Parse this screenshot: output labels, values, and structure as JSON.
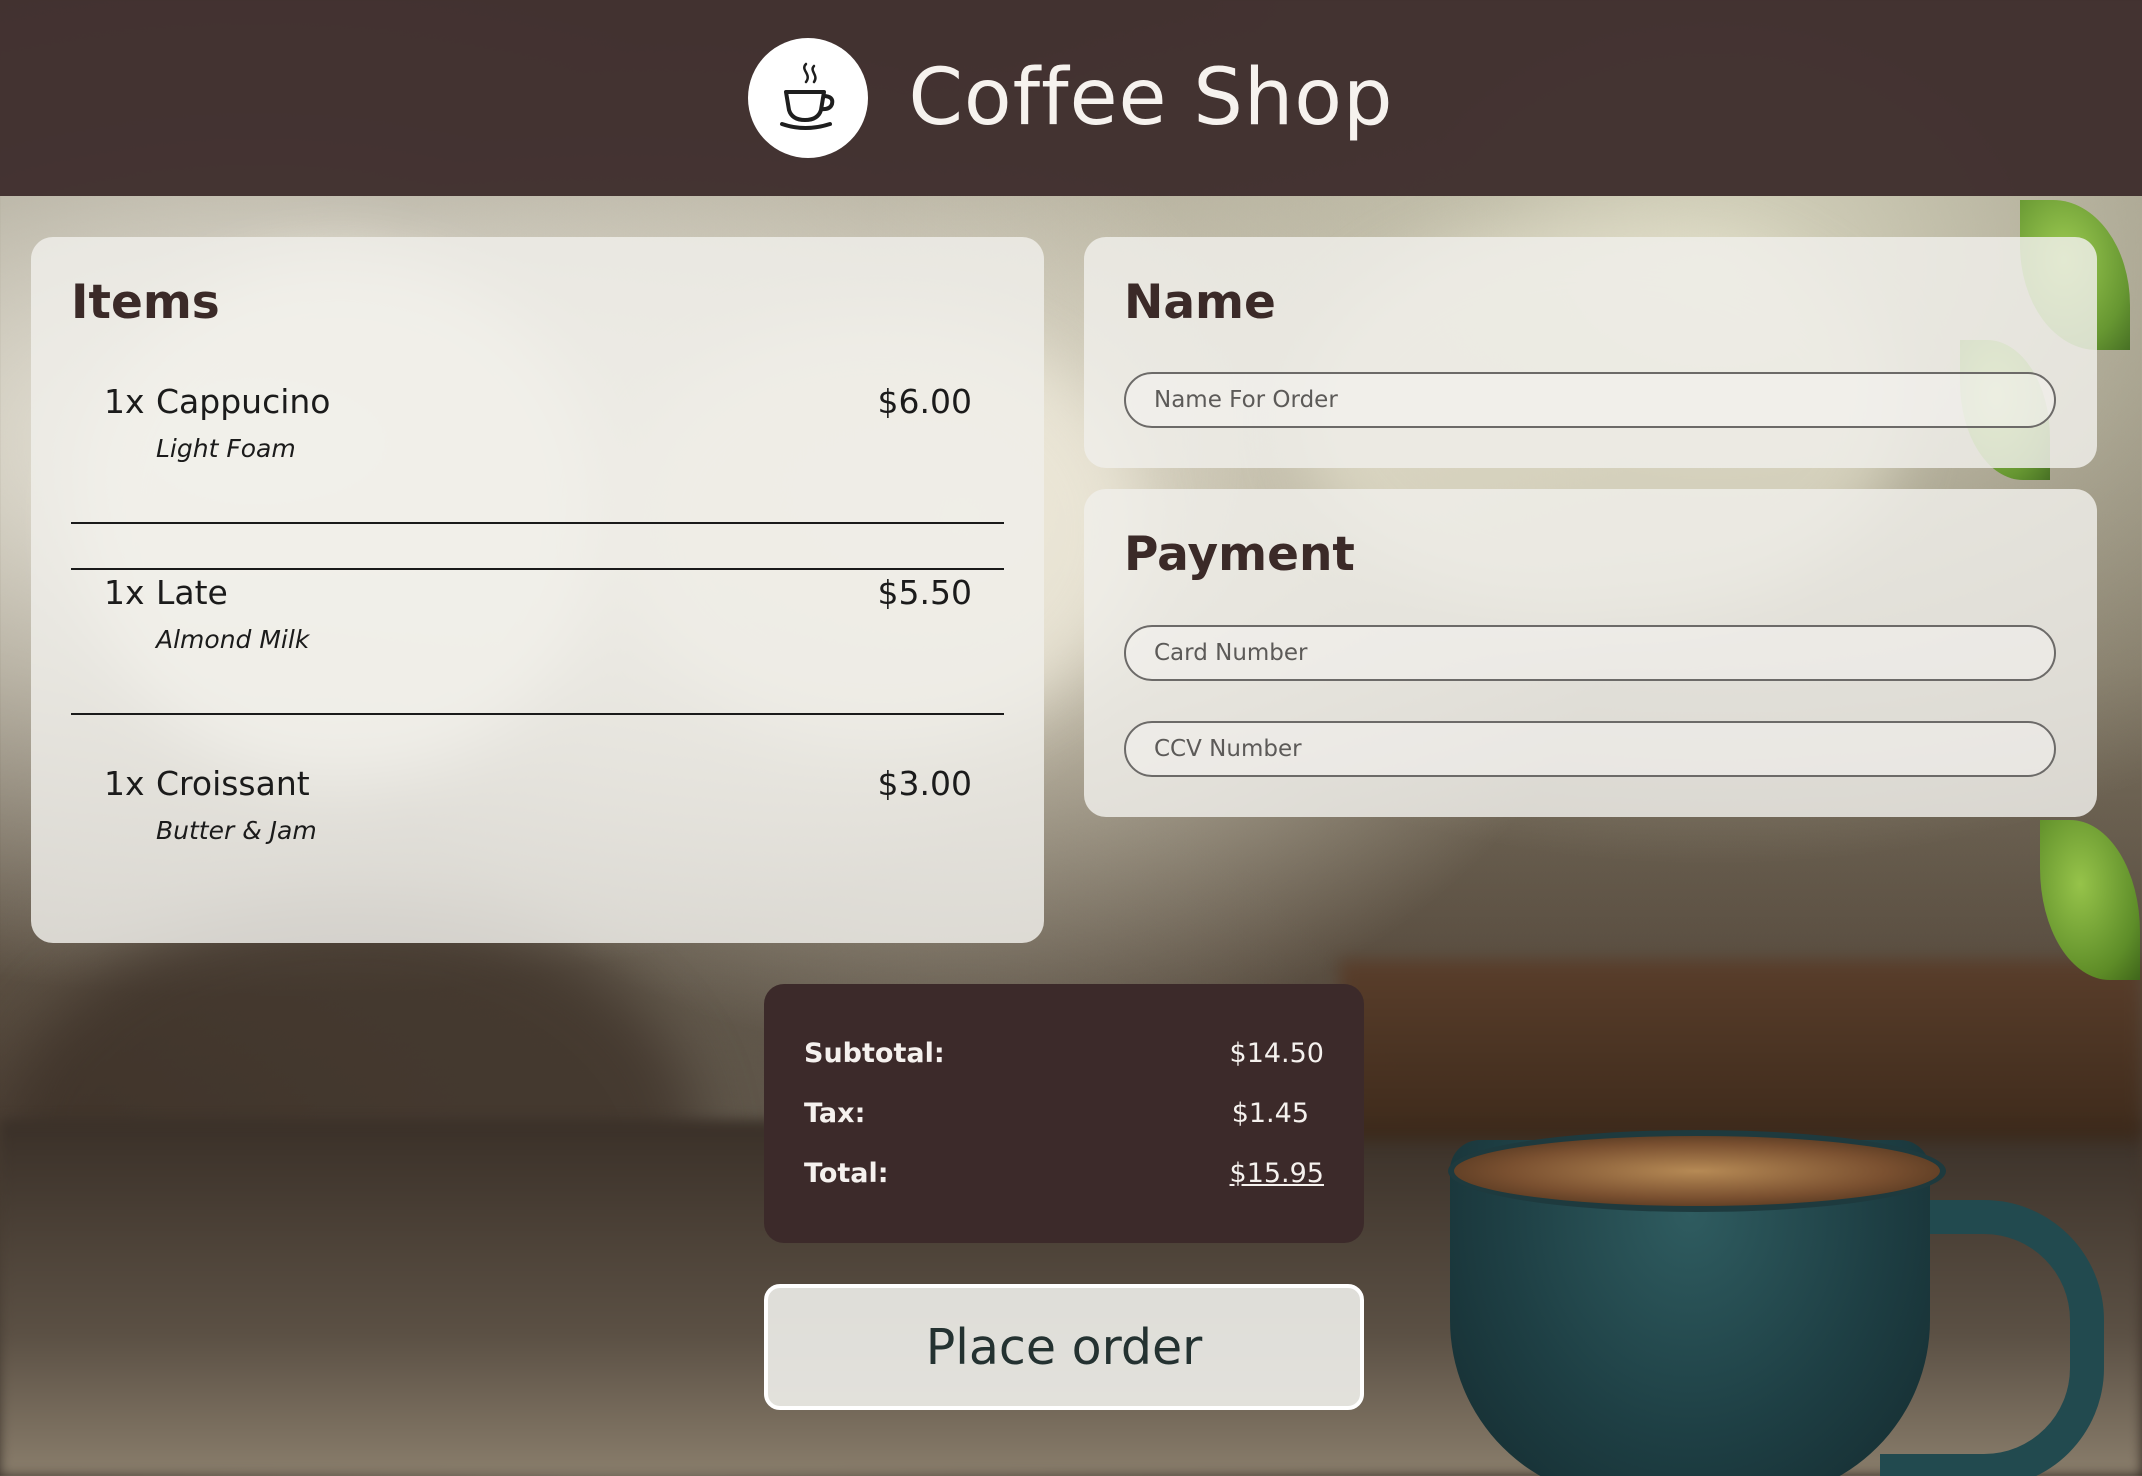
{
  "header": {
    "title": "Coffee Shop",
    "logo_icon": "coffee-cup-icon"
  },
  "items": {
    "heading": "Items",
    "list": [
      {
        "qty": "1x",
        "name": "Cappucino",
        "modifier": "Light Foam",
        "price": "$6.00"
      },
      {
        "qty": "1x",
        "name": "Late",
        "modifier": "Almond Milk",
        "price": "$5.50"
      },
      {
        "qty": "1x",
        "name": "Croissant",
        "modifier": "Butter & Jam",
        "price": "$3.00"
      }
    ]
  },
  "name_section": {
    "heading": "Name",
    "placeholder": "Name For Order",
    "value": ""
  },
  "payment": {
    "heading": "Payment",
    "card_placeholder": "Card Number",
    "ccv_placeholder": "CCV Number",
    "card_value": "",
    "ccv_value": ""
  },
  "totals": {
    "subtotal_label": "Subtotal:",
    "subtotal": "$14.50",
    "tax_label": "Tax:",
    "tax": "$1.45",
    "total_label": "Total:",
    "total": "$15.95"
  },
  "actions": {
    "place_order": "Place order"
  },
  "colors": {
    "header_bg": "#3e2e2d",
    "totals_bg": "#3c2a2a",
    "card_bg": "#f0eeea",
    "heading_text": "#3b2a28"
  }
}
